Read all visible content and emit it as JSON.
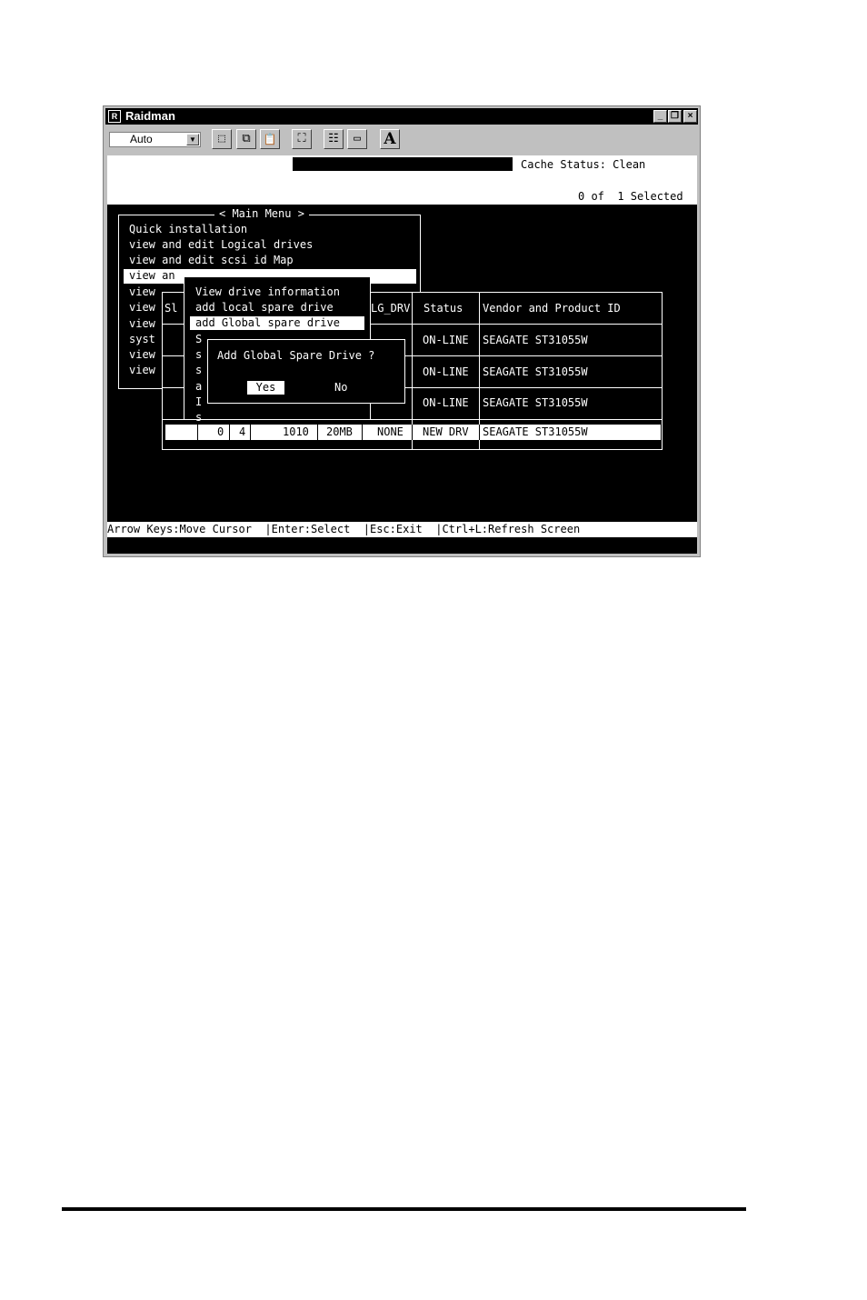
{
  "window": {
    "title": "Raidman",
    "icon": "raidman-app-icon",
    "controls": {
      "minimize": "_",
      "restore": "❐",
      "close": "×"
    }
  },
  "toolbar": {
    "combo_value": "Auto",
    "combo_arrow": "▼",
    "tools": [
      {
        "icon": "select-icon",
        "glyph": "⬚"
      },
      {
        "icon": "copy-icon",
        "glyph": "⧉"
      },
      {
        "icon": "paste-icon",
        "glyph": "📋"
      },
      {
        "icon": "fullscreen-icon",
        "glyph": "⛶"
      },
      {
        "icon": "properties-icon",
        "glyph": "☷"
      },
      {
        "icon": "background-icon",
        "glyph": "▭"
      },
      {
        "icon": "font-icon",
        "glyph": "A"
      }
    ]
  },
  "status": {
    "cache": "Cache Status: Clean",
    "selected": "0 of  1 Selected"
  },
  "main_menu": {
    "title": "< Main Menu >",
    "items": [
      "Quick installation",
      "view and edit Logical drives",
      "view and edit scsi id Map",
      "view an",
      "view",
      "view",
      "view",
      "syst",
      "view",
      "view"
    ]
  },
  "drive_table": {
    "columns": {
      "ldrv": "LG_DRV",
      "status": "Status",
      "vendor": "Vendor and Product ID"
    },
    "partial_header": "Sl",
    "rows": [
      {
        "status": "ON-LINE",
        "vendor": "SEAGATE ST31055W"
      },
      {
        "status": "ON-LINE",
        "vendor": "SEAGATE ST31055W"
      },
      {
        "status": "ON-LINE",
        "vendor": "SEAGATE ST31055W"
      }
    ],
    "selected_row": {
      "chl": "0",
      "id": "4",
      "size": "1010",
      "speed": "20MB",
      "ldrv": "NONE",
      "status": "NEW DRV",
      "vendor": "SEAGATE ST31055W"
    }
  },
  "drive_menu": {
    "items": [
      "View drive information",
      "add local spare drive",
      "add Global spare drive"
    ],
    "partial_items": [
      "S",
      "s",
      "s",
      "a",
      "I",
      "s"
    ]
  },
  "confirm_dialog": {
    "question": "Add Global Spare Drive ?",
    "yes": "Yes",
    "no": "No"
  },
  "footer": "Arrow Keys:Move Cursor  |Enter:Select  |Esc:Exit  |Ctrl+L:Refresh Screen"
}
